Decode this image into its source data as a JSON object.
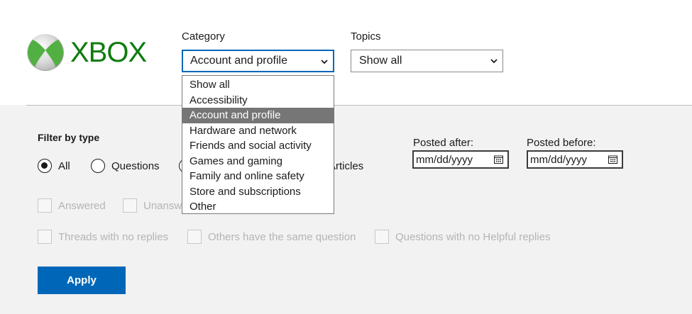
{
  "brand": {
    "name": "XBOX",
    "color": "#107c10"
  },
  "category": {
    "label": "Category",
    "selected": "Account and profile",
    "options": [
      "Show all",
      "Accessibility",
      "Account and profile",
      "Hardware and network",
      "Friends and social activity",
      "Games and gaming",
      "Family and online safety",
      "Store and subscriptions",
      "Other"
    ],
    "highlighted_index": 2
  },
  "topics": {
    "label": "Topics",
    "selected": "Show all"
  },
  "filter": {
    "title": "Filter by type",
    "types": [
      {
        "label": "All",
        "checked": true
      },
      {
        "label": "Questions",
        "checked": false
      },
      {
        "label": "Articles",
        "checked": false
      }
    ],
    "options_row1": [
      "Answered",
      "Unansw"
    ],
    "options_row2": [
      "Threads with no replies",
      "Others have the same question",
      "Questions with no Helpful replies"
    ]
  },
  "dates": {
    "after_label": "Posted after:",
    "before_label": "Posted before:",
    "after_placeholder": "mm/dd/yyyy",
    "before_placeholder": "mm/dd/yyyy"
  },
  "apply": {
    "label": "Apply",
    "color": "#0067b8"
  }
}
